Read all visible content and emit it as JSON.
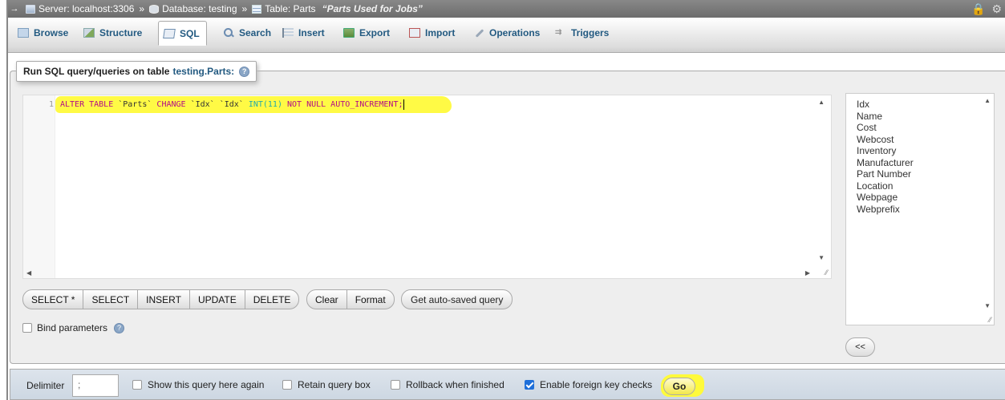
{
  "breadcrumb": {
    "arrow": "→",
    "server_label": "Server: localhost:3306",
    "sep": "»",
    "database_label": "Database: testing",
    "table_label": "Table: Parts",
    "table_comment": "“Parts Used for Jobs”"
  },
  "tabs": [
    {
      "label": "Browse",
      "icon": "browse-icon"
    },
    {
      "label": "Structure",
      "icon": "structure-icon"
    },
    {
      "label": "SQL",
      "icon": "sql-icon",
      "active": true
    },
    {
      "label": "Search",
      "icon": "search-icon"
    },
    {
      "label": "Insert",
      "icon": "insert-icon"
    },
    {
      "label": "Export",
      "icon": "export-icon"
    },
    {
      "label": "Import",
      "icon": "import-icon"
    },
    {
      "label": "Operations",
      "icon": "operations-icon"
    },
    {
      "label": "Triggers",
      "icon": "triggers-icon"
    }
  ],
  "panel": {
    "legend_prefix": "Run SQL query/queries on table",
    "legend_table": "testing.Parts:"
  },
  "editor": {
    "line_number": "1",
    "tokens": {
      "alter": "ALTER TABLE ",
      "table": "`Parts` ",
      "change": "CHANGE ",
      "col1": "`Idx` ",
      "col2": "`Idx` ",
      "type": "INT(11) ",
      "rest": "NOT NULL AUTO_INCREMENT;"
    }
  },
  "buttons": {
    "select_star": "SELECT *",
    "select": "SELECT",
    "insert": "INSERT",
    "update": "UPDATE",
    "delete": "DELETE",
    "clear": "Clear",
    "format": "Format",
    "get_autosaved": "Get auto-saved query",
    "insert_field": "<<"
  },
  "bind_parameters": {
    "label": "Bind parameters",
    "checked": false
  },
  "fields": [
    "Idx",
    "Name",
    "Cost",
    "Webcost",
    "Inventory",
    "Manufacturer",
    "Part Number",
    "Location",
    "Webpage",
    "Webprefix"
  ],
  "footer": {
    "delimiter_label": "Delimiter",
    "delimiter_value": ";",
    "show_query_label": "Show this query here again",
    "retain_label": "Retain query box",
    "rollback_label": "Rollback when finished",
    "foreign_key_label": "Enable foreign key checks",
    "go_label": "Go"
  },
  "colors": {
    "highlight": "#fffa3b",
    "link": "#235a81",
    "checkbox_checked": "#1e6fd9"
  }
}
